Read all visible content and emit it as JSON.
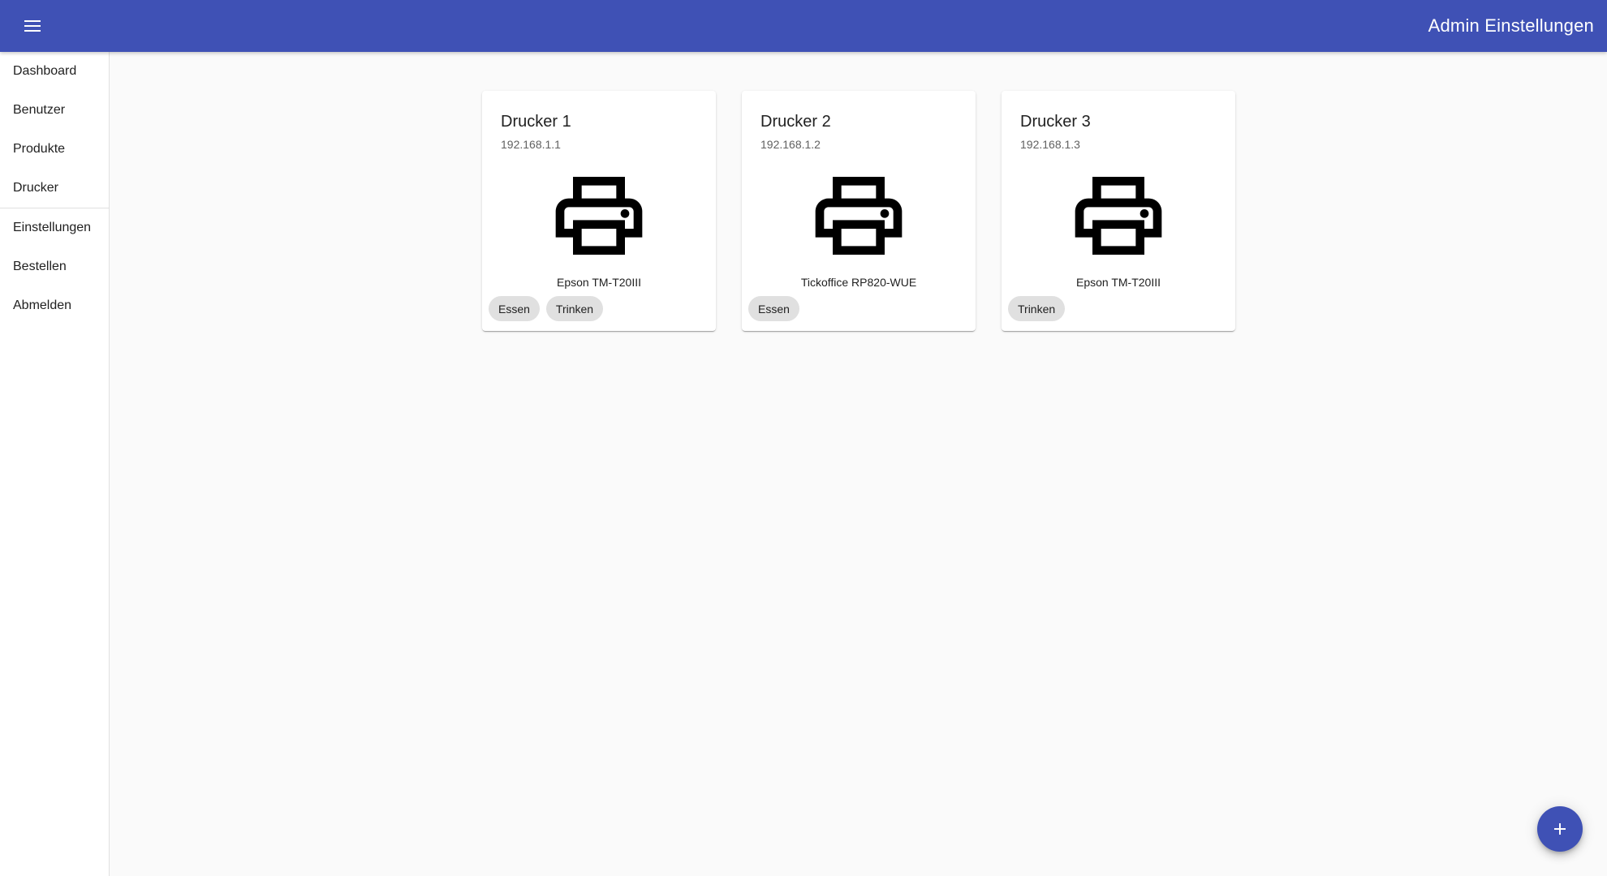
{
  "header": {
    "menu_icon": "menu-icon",
    "title": "Admin Einstellungen",
    "color": "#3f51b5"
  },
  "sidebar": {
    "items": [
      {
        "label": "Dashboard"
      },
      {
        "label": "Benutzer"
      },
      {
        "label": "Produkte"
      },
      {
        "label": "Drucker"
      },
      {
        "label": "Einstellungen"
      },
      {
        "label": "Bestellen"
      },
      {
        "label": "Abmelden"
      }
    ]
  },
  "printers": [
    {
      "name": "Drucker 1",
      "ip": "192.168.1.1",
      "model": "Epson TM-T20III",
      "tags": [
        "Essen",
        "Trinken"
      ]
    },
    {
      "name": "Drucker 2",
      "ip": "192.168.1.2",
      "model": "Tickoffice RP820-WUE",
      "tags": [
        "Essen"
      ]
    },
    {
      "name": "Drucker 3",
      "ip": "192.168.1.3",
      "model": "Epson TM-T20III",
      "tags": [
        "Trinken"
      ]
    }
  ],
  "fab": {
    "icon": "add-icon"
  }
}
